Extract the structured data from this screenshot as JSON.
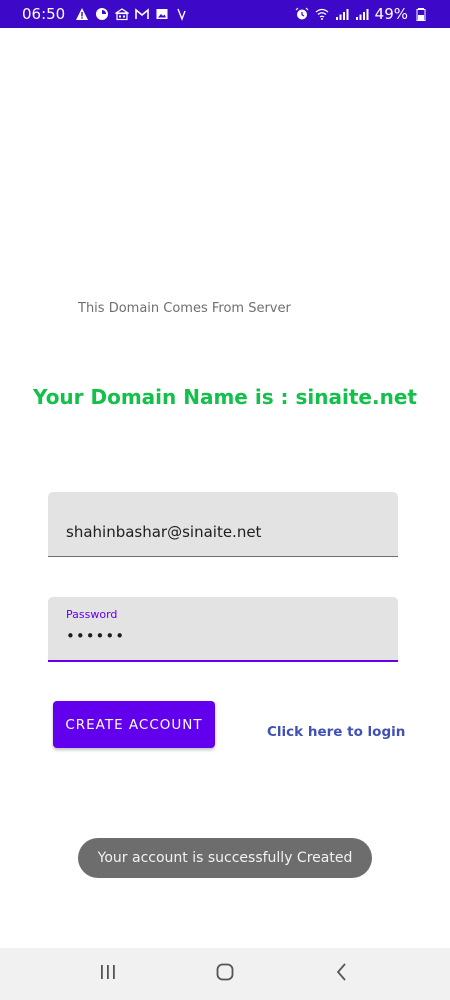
{
  "status_bar": {
    "time": "06:50",
    "battery_percent": "49%",
    "left_icons": [
      "warning-icon",
      "data-saver-icon",
      "building-icon",
      "gmail-icon",
      "gallery-icon",
      "v-icon"
    ],
    "right_icons": [
      "alarm-icon",
      "wifi-icon",
      "signal-icon",
      "signal-icon",
      "battery-icon"
    ],
    "background_color": "#3d08c8"
  },
  "content": {
    "domain_source_text": "This Domain Comes From Server",
    "domain_name_text": "Your Domain Name is : sinaite.net",
    "domain_name_color": "#13c04a"
  },
  "form": {
    "email_value": "shahinbashar@sinaite.net",
    "password_label": "Password",
    "password_value": "••••••",
    "accent_color": "#6200ee"
  },
  "actions": {
    "create_account_label": "CREATE ACCOUNT",
    "login_link_label": "Click here to login"
  },
  "toast": {
    "message": "Your account is successfully Created"
  },
  "nav_bar": {
    "buttons": [
      "recent-apps-icon",
      "home-icon",
      "back-icon"
    ]
  }
}
